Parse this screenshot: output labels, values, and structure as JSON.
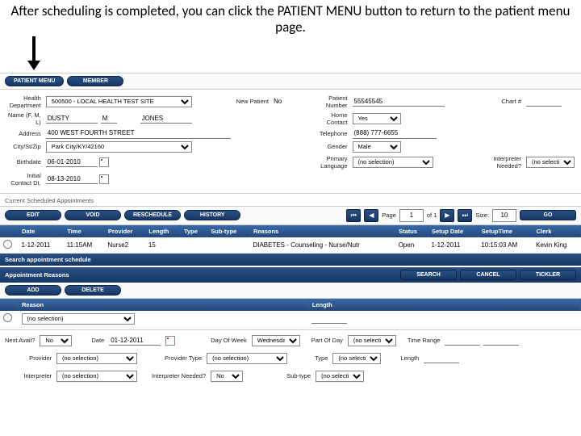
{
  "caption": "After scheduling is completed, you can click the PATIENT MENU button to return to the patient menu page.",
  "top": {
    "patient_menu": "PATIENT MENU",
    "member": "MEMBER"
  },
  "pt": {
    "health_dept_lbl": "Health\nDepartment",
    "health_dept": "500500 - LOCAL HEALTH TEST SITE",
    "new_patient_lbl": "New Patient",
    "new_patient": "No",
    "patient_no_lbl": "Patient Number",
    "patient_no": "55545545",
    "chart_lbl": "Chart #",
    "chart": "",
    "name_lbl": "Name (F, M, L)",
    "name_f": "DUSTY",
    "name_m": "M",
    "name_l": "JONES",
    "home_contact_lbl": "Home Contact",
    "home_contact": "Yes",
    "address_lbl": "Address",
    "address": "400 WEST FOURTH STREET",
    "phone_lbl": "Telephone",
    "phone": "(888) 777-6655",
    "city_lbl": "City/St/Zip",
    "city": "Park City/KY/42160",
    "gender_lbl": "Gender",
    "gender": "Male",
    "birth_lbl": "Birthdate",
    "birth": "06-01-2010",
    "lang_lbl": "Primary\nLanguage",
    "lang": "(no selection)",
    "interp_need_lbl": "Interpreter\nNeeded?",
    "interp_need": "(no selection)",
    "initc_lbl": "Initial Contact Dt.",
    "initc": "08-13-2010"
  },
  "schedhdr": "Current Scheduled Appointments",
  "schedbtns": {
    "edit": "EDIT",
    "void": "VOID",
    "resched": "RESCHEDULE",
    "history": "HISTORY"
  },
  "pager": {
    "page_lbl": "Page",
    "page": "1",
    "of": "of 1",
    "size_lbl": "Size:",
    "size": "10",
    "go": "GO"
  },
  "cols": {
    "date": "Date",
    "time": "Time",
    "provider": "Provider",
    "length": "Length",
    "type": "Type",
    "subtype": "Sub-type",
    "reasons": "Reasons",
    "status": "Status",
    "setupdate": "Setup Date",
    "setuptime": "SetupTime",
    "clerk": "Clerk"
  },
  "row": {
    "date": "1-12-2011",
    "time": "11:15AM",
    "provider": "Nurse2",
    "length": "15",
    "type": "",
    "subtype": "",
    "reasons": "DIABETES - Counseling - Nurse/Nutr",
    "status": "Open",
    "setupdate": "1-12-2011",
    "setuptime": "10:15:03 AM",
    "clerk": "Kevin King"
  },
  "search_sched": "Search appointment schedule",
  "reasons_hdr": "Appointment Reasons",
  "rbtns": {
    "search": "SEARCH",
    "cancel": "CANCEL",
    "tickler": "TICKLER",
    "add": "ADD",
    "delete": "DELETE"
  },
  "rcols": {
    "reason": "Reason",
    "length": "Length"
  },
  "rrow": {
    "reason": "(no selection)",
    "length": ""
  },
  "crit": {
    "nextavail_lbl": "Next Avail?",
    "nextavail": "No",
    "date_lbl": "Date",
    "date": "01-12-2011",
    "dow_lbl": "Day Of Week",
    "dow": "Wednesday",
    "pod_lbl": "Part Of Day",
    "pod": "(no selection)",
    "range_lbl": "Time Range",
    "range_a": "",
    "range_b": "",
    "prov_lbl": "Provider",
    "prov": "(no selection)",
    "provtype_lbl": "Provider Type",
    "provtype": "(no selection)",
    "type_lbl": "Type",
    "type": "(no selection)",
    "length_lbl": "Length",
    "length": "",
    "interp_lbl": "Interpreter",
    "interp": "(no selection)",
    "interpn_lbl": "Interpreter Needed?",
    "interpn": "No",
    "subtype_lbl": "Sub-type",
    "subtype": "(no selection)"
  }
}
